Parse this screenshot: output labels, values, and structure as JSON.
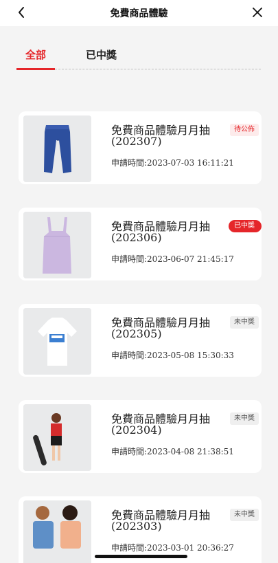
{
  "header": {
    "title": "免費商品體驗",
    "back_icon": "chevron-left-icon",
    "close_icon": "close-icon"
  },
  "tabs": [
    {
      "label": "全部",
      "active": true
    },
    {
      "label": "已中獎",
      "active": false
    }
  ],
  "colors": {
    "accent": "#e5262a",
    "background": "#f4f4f4",
    "card": "#ffffff"
  },
  "entries": [
    {
      "name": "免費商品體驗月月抽(202307)",
      "time_label": "申請時間:",
      "time": "2023-07-03 16:11:21",
      "status": "待公佈",
      "status_type": "pending",
      "image": "blue-pants-image"
    },
    {
      "name": "免費商品體驗月月抽(202306)",
      "time_label": "申請時間:",
      "time": "2023-06-07 21:45:17",
      "status": "已中獎",
      "status_type": "won",
      "image": "lilac-camisole-image"
    },
    {
      "name": "免費商品體驗月月抽(202305)",
      "time_label": "申請時間:",
      "time": "2023-05-08 15:30:33",
      "status": "未中獎",
      "status_type": "lost",
      "image": "white-graphic-tee-image"
    },
    {
      "name": "免費商品體驗月月抽(202304)",
      "time_label": "申請時間:",
      "time": "2023-04-08 21:38:51",
      "status": "未中獎",
      "status_type": "lost",
      "image": "child-with-skateboard-image"
    },
    {
      "name": "免費商品體驗月月抽(202303)",
      "time_label": "申請時間:",
      "time": "2023-03-01 20:36:27",
      "status": "未中獎",
      "status_type": "lost",
      "image": "two-children-image"
    }
  ]
}
